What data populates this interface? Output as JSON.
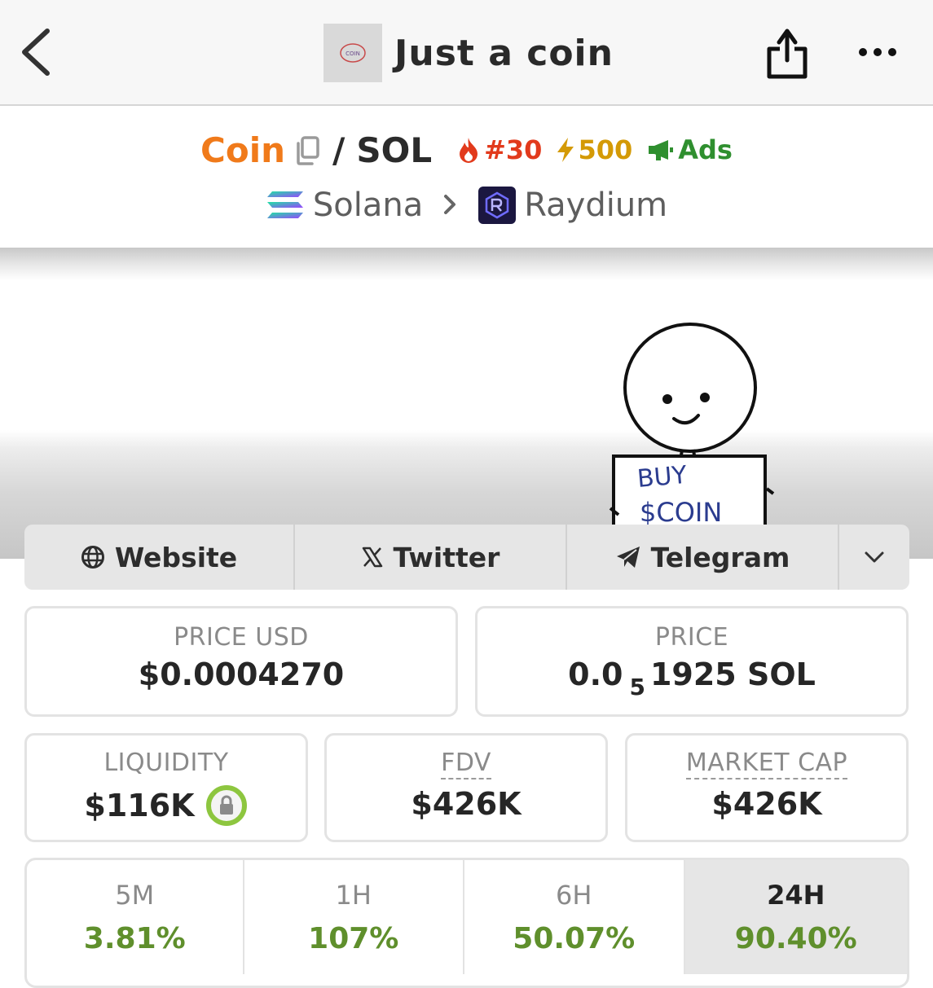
{
  "header": {
    "title": "Just a coin",
    "logo_text": "COIN"
  },
  "pair": {
    "base_symbol": "Coin",
    "separator": "/",
    "quote_symbol": "SOL",
    "trending_rank": "#30",
    "boost_count": "500",
    "ads_label": "Ads",
    "chain": "Solana",
    "dex": "Raydium"
  },
  "banner": {
    "sign_line1": "BUY",
    "sign_line2": "$COIN"
  },
  "links": {
    "website": "Website",
    "twitter": "Twitter",
    "telegram": "Telegram"
  },
  "stats": {
    "price_usd_label": "PRICE USD",
    "price_usd_value": "$0.0004270",
    "price_label": "PRICE",
    "price_prefix": "0.0",
    "price_zero_count": "5",
    "price_suffix": "1925 SOL",
    "liquidity_label": "LIQUIDITY",
    "liquidity_value": "$116K",
    "fdv_label": "FDV",
    "fdv_value": "$426K",
    "mcap_label": "MARKET CAP",
    "mcap_value": "$426K"
  },
  "timeframes": [
    {
      "label": "5M",
      "value": "3.81%"
    },
    {
      "label": "1H",
      "value": "107%"
    },
    {
      "label": "6H",
      "value": "50.07%"
    },
    {
      "label": "24H",
      "value": "90.40%"
    }
  ],
  "colors": {
    "base_symbol": "#f07a1a",
    "trending": "#e23a1c",
    "boost": "#d49a06",
    "ads": "#2f8f2f",
    "positive_change": "#5f8f2c",
    "lock_ring": "#8dc63f"
  }
}
